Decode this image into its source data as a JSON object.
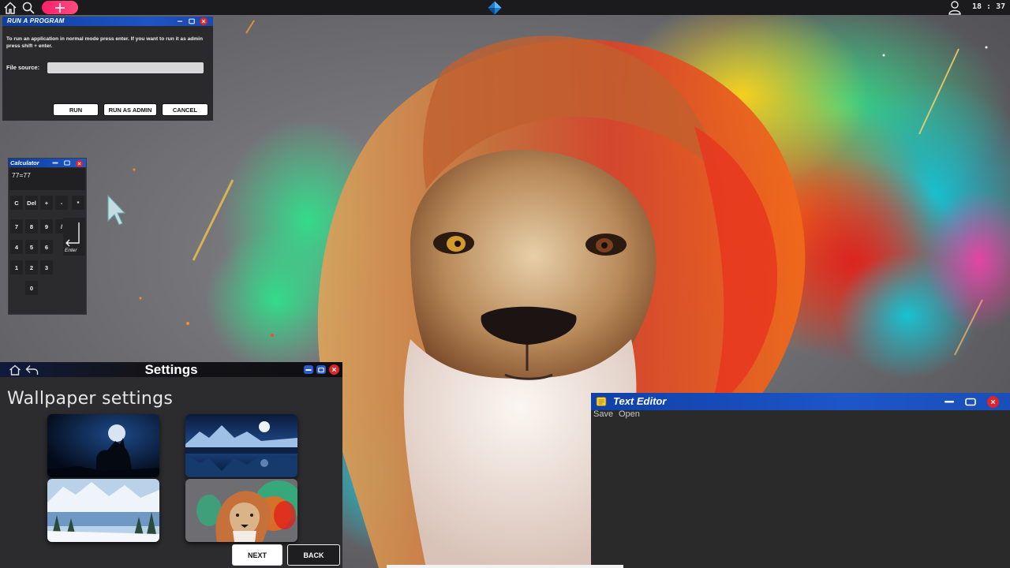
{
  "topbar": {
    "home_icon": "home-icon",
    "search_icon": "search-icon",
    "add_icon": "plus-icon",
    "logo_icon": "diamond-logo-icon",
    "user_icon": "user-icon",
    "clock": "18 : 37",
    "accent": "#ff2a6d"
  },
  "run_dialog": {
    "title": "RUN A PROGRAM",
    "description": "To run an application in normal mode press enter. If you want to run it as admin press shift + enter.",
    "file_source_label": "File source:",
    "file_source_value": "",
    "buttons": {
      "run": "RUN",
      "run_admin": "RUN AS ADMIN",
      "cancel": "CANCEL"
    }
  },
  "calculator": {
    "title": "Calculator",
    "display": "77=77",
    "keys": [
      "C",
      "Del",
      "+",
      "-",
      "*",
      "7",
      "8",
      "9",
      "/",
      "4",
      "5",
      "6",
      "1",
      "2",
      "3",
      "0"
    ],
    "enter_label": "Enter"
  },
  "settings": {
    "title": "Settings",
    "subtitle": "Wallpaper settings",
    "wallpapers": [
      "wolf-moon",
      "mountain-lake-moon",
      "snowy-mountain-lake",
      "colorful-lion"
    ],
    "buttons": {
      "next": "NEXT",
      "back": "BACK"
    }
  },
  "text_editor": {
    "title": "Text Editor",
    "menu": {
      "save": "Save",
      "open": "Open"
    },
    "content": ""
  },
  "colors": {
    "titlebar_blue": "#1d56c6",
    "window_bg": "#2a2a2c",
    "close_red": "#e0242b"
  }
}
